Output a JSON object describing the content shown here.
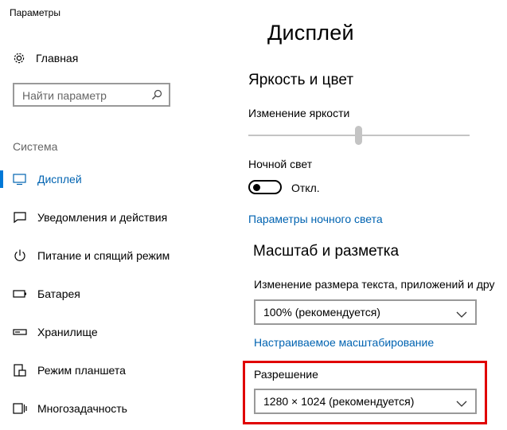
{
  "window": {
    "title": "Параметры"
  },
  "sidebar": {
    "home_label": "Главная",
    "search_placeholder": "Найти параметр",
    "section_label": "Система",
    "items": [
      {
        "label": "Дисплей",
        "icon": "monitor-icon",
        "active": true
      },
      {
        "label": "Уведомления и действия",
        "icon": "notifications-icon",
        "active": false
      },
      {
        "label": "Питание и спящий режим",
        "icon": "power-icon",
        "active": false
      },
      {
        "label": "Батарея",
        "icon": "battery-icon",
        "active": false
      },
      {
        "label": "Хранилище",
        "icon": "storage-icon",
        "active": false
      },
      {
        "label": "Режим планшета",
        "icon": "tablet-icon",
        "active": false
      },
      {
        "label": "Многозадачность",
        "icon": "multitasking-icon",
        "active": false
      }
    ]
  },
  "main": {
    "title": "Дисплей",
    "brightness": {
      "heading": "Яркость и цвет",
      "brightness_label": "Изменение яркости",
      "brightness_level": 0.5,
      "night_light_label": "Ночной свет",
      "night_light_state": "Откл.",
      "night_light_settings_link": "Параметры ночного света"
    },
    "scale": {
      "heading": "Масштаб и разметка",
      "text_size_label": "Изменение размера текста, приложений и дру",
      "text_size_value": "100% (рекомендуется)",
      "custom_scaling_link": "Настраиваемое масштабирование",
      "resolution_label": "Разрешение",
      "resolution_value": "1280 × 1024 (рекомендуется)"
    }
  },
  "colors": {
    "accent": "#0078d7",
    "link": "#0063b1",
    "highlight": "#e00000"
  }
}
